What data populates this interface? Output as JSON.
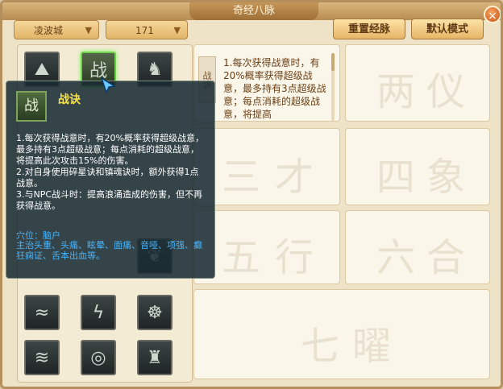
{
  "window": {
    "title": "奇经八脉",
    "close_label": "×"
  },
  "toolbar": {
    "city": "凌波城",
    "level": "171",
    "reset_label": "重置经脉",
    "default_label": "默认模式"
  },
  "grid": {
    "icons": [
      {
        "name": "mountain-skill-icon",
        "glyph": "⛰"
      },
      {
        "name": "zhanjue-skill-icon",
        "glyph": "战"
      },
      {
        "name": "warrior-skill-icon",
        "glyph": "♞"
      },
      {
        "name": "sword-aura-skill-icon",
        "glyph": "⚔"
      },
      {
        "name": "figure-skill-icon",
        "glyph": "♟"
      },
      {
        "name": "leaf-skill-icon",
        "glyph": "❦"
      },
      {
        "name": "wave-skill-icon",
        "glyph": "≈"
      },
      {
        "name": "lightning-skill-icon",
        "glyph": "ϟ"
      },
      {
        "name": "monk-skill-icon",
        "glyph": "☸"
      },
      {
        "name": "claw-skill-icon",
        "glyph": "≋"
      },
      {
        "name": "spiral-skill-icon",
        "glyph": "◎"
      },
      {
        "name": "staff-skill-icon",
        "glyph": "♜"
      }
    ]
  },
  "tooltip": {
    "title": "战诀",
    "icon_glyph": "战",
    "desc": [
      "1.每次获得战意时，有20%概率获得超级战意，最多持有3点超级战意；每点消耗的超级战意，将提高此次攻击15%的伤害。",
      "2.对自身使用碎星诀和镇魂诀时，额外获得1点战意。",
      "3.与NPC战斗时：提高浪涌造成的伤害，但不再获得战意。"
    ],
    "acupoint": "穴位：脑户",
    "effect": "主治头重、头痛、眩晕、面痛、音哑、项强、癫狂痫证、舌本出血等。"
  },
  "info": {
    "tab_label": "战诀",
    "text": "1.每次获得战意时，有20%概率获得超级战意，最多持有3点超级战意；每点消耗的超级战意，将提高"
  },
  "ghosts": [
    "两",
    "仪",
    "三",
    "才",
    "四",
    "象",
    "五",
    "行",
    "六",
    "合",
    "七",
    "曜"
  ],
  "colors": {
    "accent_gold": "#f7e24b",
    "accent_blue": "#46b6ff",
    "active_green": "#6cd24a"
  }
}
